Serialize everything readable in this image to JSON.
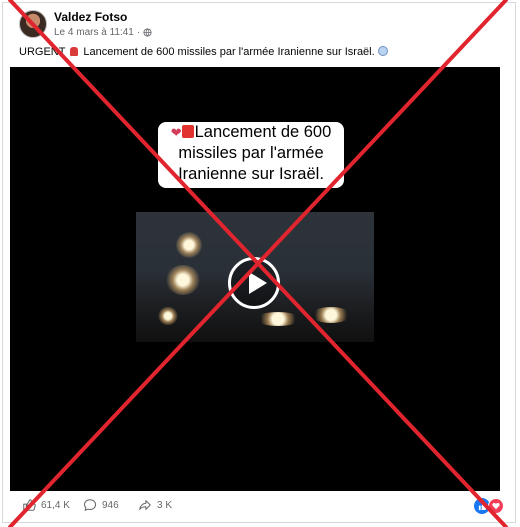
{
  "post": {
    "author": "Valdez Fotso",
    "date": "Le 4 mars à 11:41",
    "separator": "·",
    "caption_prefix": "URGENT",
    "caption_text": "Lancement de 600 missiles par l'armée Iranienne sur Israël.",
    "privacy_icon": "globe-icon"
  },
  "video": {
    "overlay_line1": "Lancement de 600",
    "overlay_line2": "missiles par l'armée",
    "overlay_line3": "Iranienne sur Israël.",
    "play_icon": "play-icon"
  },
  "footer": {
    "likes": "61,4 K",
    "comments": "946",
    "shares": "3 K"
  },
  "colors": {
    "fact_check_cross": "#e0252e",
    "facebook_blue": "#1877f2",
    "muted_text": "#65676b"
  }
}
